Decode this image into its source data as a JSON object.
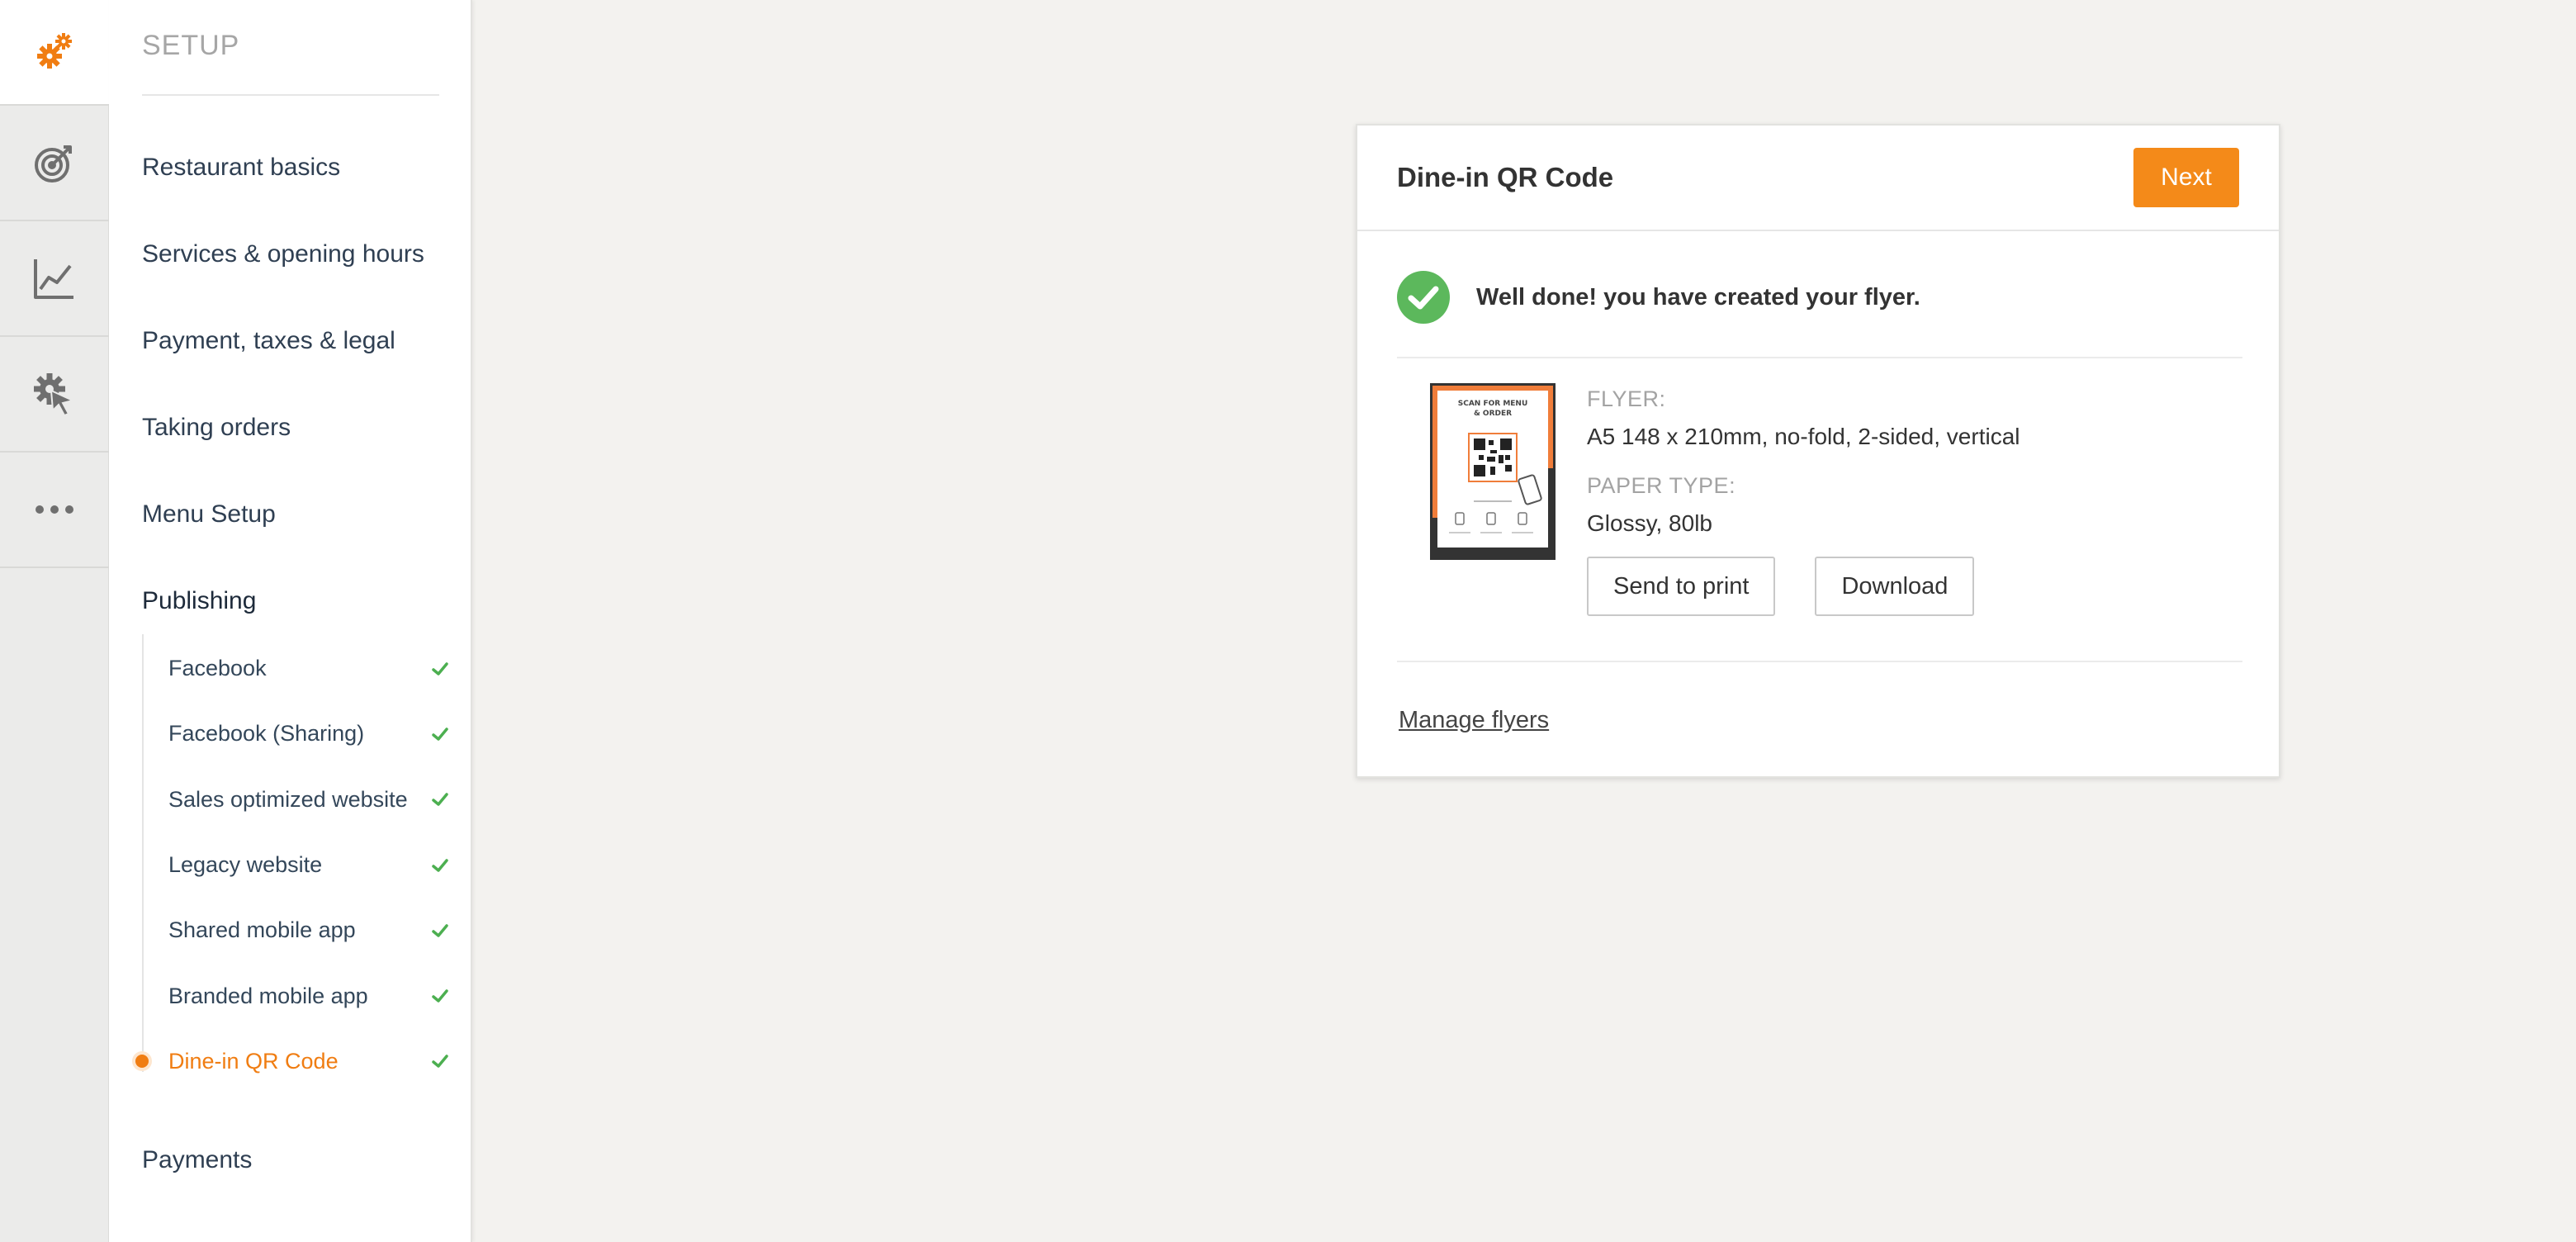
{
  "rail": {
    "items": [
      {
        "icon": "gears-icon",
        "active": true
      },
      {
        "icon": "target-icon"
      },
      {
        "icon": "chart-icon"
      },
      {
        "icon": "cursor-gear-icon"
      },
      {
        "icon": "more-icon"
      }
    ],
    "accent_color": "#f07d12"
  },
  "sidebar": {
    "title": "SETUP",
    "top_items": [
      {
        "label": "Restaurant basics"
      },
      {
        "label": "Services & opening hours"
      },
      {
        "label": "Payment, taxes & legal"
      },
      {
        "label": "Taking orders"
      },
      {
        "label": "Menu Setup"
      },
      {
        "label": "Publishing"
      }
    ],
    "sub_items": [
      {
        "label": "Facebook",
        "done": true
      },
      {
        "label": "Facebook (Sharing)",
        "done": true
      },
      {
        "label": "Sales optimized website",
        "done": true
      },
      {
        "label": "Legacy website",
        "done": true
      },
      {
        "label": "Shared mobile app",
        "done": true
      },
      {
        "label": "Branded mobile app",
        "done": true
      },
      {
        "label": "Dine-in QR Code",
        "done": true,
        "active": true
      }
    ],
    "bottom_items": [
      {
        "label": "Payments"
      }
    ]
  },
  "card": {
    "title": "Dine-in QR Code",
    "next_label": "Next",
    "success_message": "Well done! you have created your flyer.",
    "flyer_label": "FLYER:",
    "flyer_value": "A5 148 x 210mm, no-fold, 2-sided, vertical",
    "paper_label": "PAPER TYPE:",
    "paper_value": "Glossy, 80lb",
    "send_to_print_label": "Send to print",
    "download_label": "Download",
    "manage_link": "Manage flyers",
    "flyer_thumb_text": "SCAN FOR MENU & ORDER"
  },
  "colors": {
    "accent": "#f48a19",
    "success": "#5cb85c",
    "check": "#4caf50"
  }
}
